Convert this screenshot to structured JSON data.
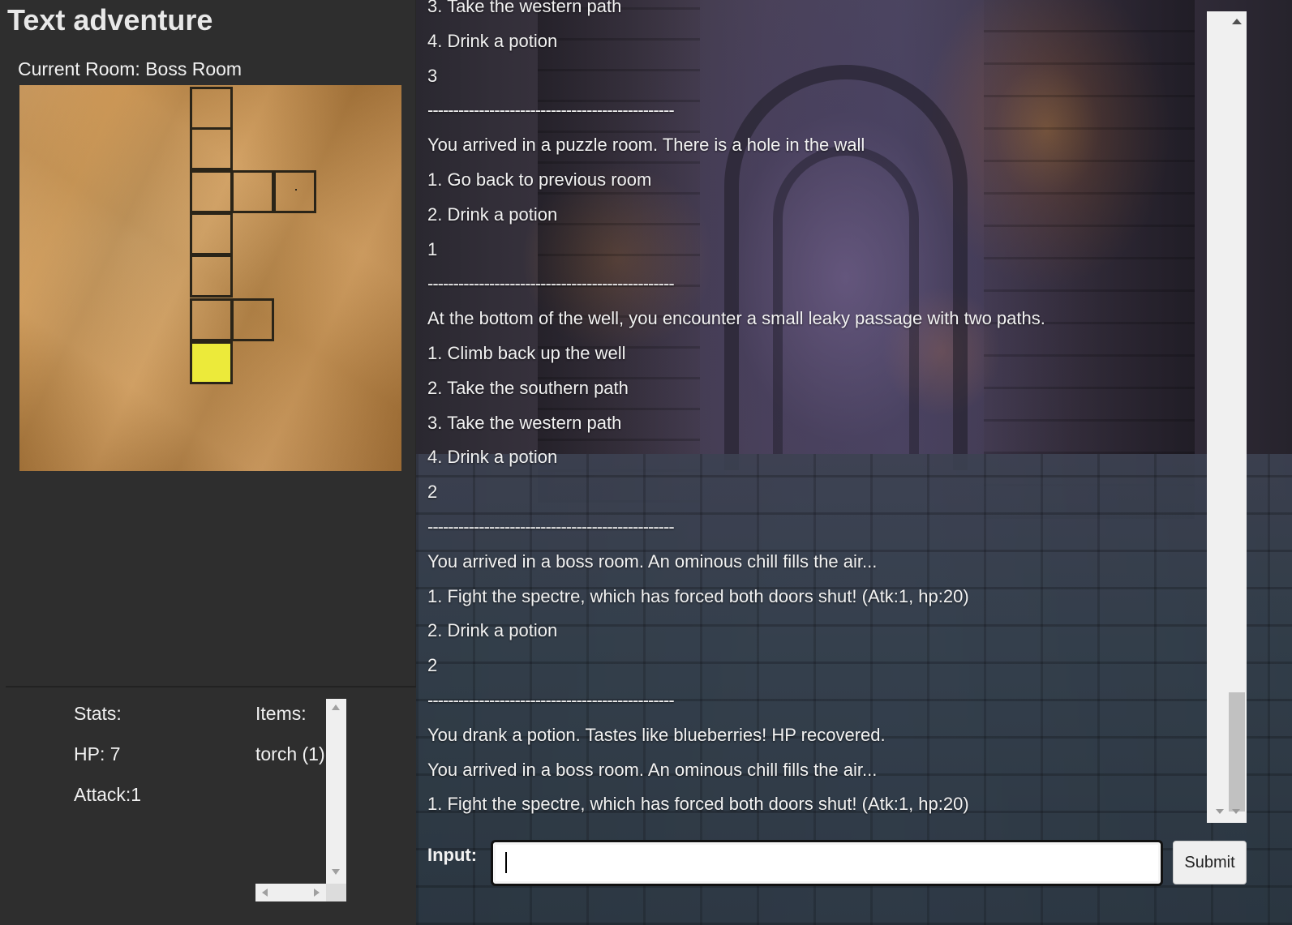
{
  "app": {
    "title": "Text adventure",
    "current_room_label": "Current Room: Boss Room"
  },
  "map": {
    "current_color": "#ecea3a",
    "paper_color": "#c9914c"
  },
  "stats": {
    "label": "Stats:",
    "hp": "HP: 7",
    "attack": "Attack:1"
  },
  "items": {
    "label": "Items:",
    "list": [
      "torch (1)"
    ]
  },
  "log": [
    "3. Take the western path",
    "4. Drink a potion",
    "3",
    "------------------------------------------------",
    "You arrived in a puzzle room. There is a hole in the wall",
    "1. Go back to previous room",
    "2. Drink a potion",
    "1",
    "------------------------------------------------",
    "At the bottom of the well, you encounter a small leaky passage with two paths.",
    "1. Climb back up the well",
    "2. Take the southern path",
    "3. Take the western path",
    "4. Drink a potion",
    "2",
    "------------------------------------------------",
    "You arrived in a boss room. An ominous chill fills the air...",
    "1. Fight the spectre, which has forced both doors shut! (Atk:1, hp:20)",
    "2. Drink a potion",
    "2",
    "------------------------------------------------",
    "You drank a potion. Tastes like blueberries! HP recovered.",
    "You arrived in a boss room. An ominous chill fills the air...",
    "1. Fight the spectre, which has forced both doors shut! (Atk:1, hp:20)"
  ],
  "input": {
    "label": "Input:",
    "value": "",
    "submit_label": "Submit"
  }
}
